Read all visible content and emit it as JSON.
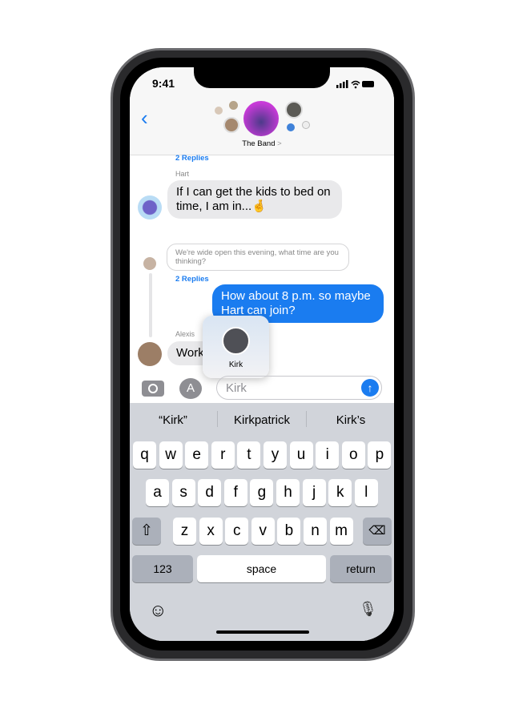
{
  "status": {
    "time": "9:41"
  },
  "header": {
    "group_name": "The Band",
    "chevron": ">"
  },
  "messages": [
    {
      "replies": "2 Replies"
    },
    {
      "sender": "Hart",
      "text": "If I can get the kids to bed on time, I am in...🤞"
    },
    {
      "quoted": "We're wide open this evening, what time are you thinking?",
      "replies": "2 Replies"
    },
    {
      "text": "How about 8 p.m. so maybe Hart can join?"
    },
    {
      "sender": "Alexis",
      "text": "Work"
    }
  ],
  "mention_popup": {
    "name": "Kirk"
  },
  "input": {
    "value": "Kirk"
  },
  "suggestions": [
    "“Kirk”",
    "Kirkpatrick",
    "Kirk’s"
  ],
  "keyboard": {
    "row1": [
      "q",
      "w",
      "e",
      "r",
      "t",
      "y",
      "u",
      "i",
      "o",
      "p"
    ],
    "row2": [
      "a",
      "s",
      "d",
      "f",
      "g",
      "h",
      "j",
      "k",
      "l"
    ],
    "row3": [
      "z",
      "x",
      "c",
      "v",
      "b",
      "n",
      "m"
    ],
    "numbers": "123",
    "space": "space",
    "return": "return"
  },
  "colors": {
    "accent": "#1a7cf0",
    "bubble_gray": "#e9e9eb",
    "keyboard_bg": "#d1d4da"
  }
}
